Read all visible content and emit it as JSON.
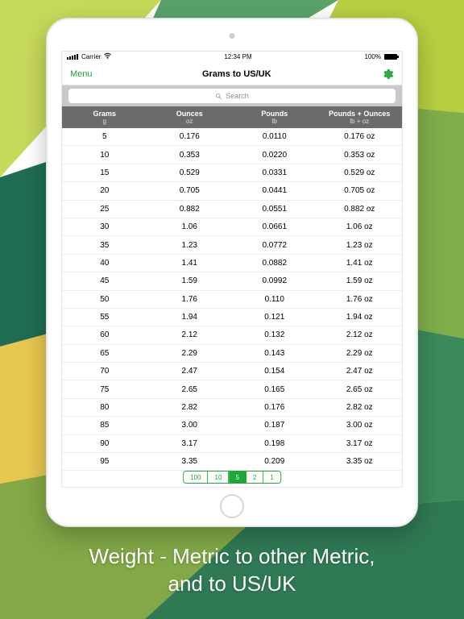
{
  "caption_line1": "Weight - Metric to other Metric,",
  "caption_line2": "and to US/UK",
  "status": {
    "carrier": "Carrier",
    "time": "12:34 PM",
    "battery": "100%"
  },
  "navbar": {
    "menu": "Menu",
    "title": "Grams to US/UK"
  },
  "search": {
    "placeholder": "Search"
  },
  "columns": [
    {
      "label": "Grams",
      "unit": "g"
    },
    {
      "label": "Ounces",
      "unit": "oz"
    },
    {
      "label": "Pounds",
      "unit": "lb"
    },
    {
      "label": "Pounds + Ounces",
      "unit": "lb + oz"
    }
  ],
  "segments": [
    "100",
    "10",
    "5",
    "2",
    "1"
  ],
  "active_segment": "5",
  "chart_data": {
    "type": "table",
    "columns": [
      "Grams (g)",
      "Ounces (oz)",
      "Pounds (lb)",
      "Pounds + Ounces (lb + oz)"
    ],
    "rows": [
      [
        "5",
        "0.176",
        "0.0110",
        "0.176 oz"
      ],
      [
        "10",
        "0.353",
        "0.0220",
        "0.353 oz"
      ],
      [
        "15",
        "0.529",
        "0.0331",
        "0.529 oz"
      ],
      [
        "20",
        "0.705",
        "0.0441",
        "0.705 oz"
      ],
      [
        "25",
        "0.882",
        "0.0551",
        "0.882 oz"
      ],
      [
        "30",
        "1.06",
        "0.0661",
        "1.06 oz"
      ],
      [
        "35",
        "1.23",
        "0.0772",
        "1.23 oz"
      ],
      [
        "40",
        "1.41",
        "0.0882",
        "1.41 oz"
      ],
      [
        "45",
        "1.59",
        "0.0992",
        "1.59 oz"
      ],
      [
        "50",
        "1.76",
        "0.110",
        "1.76 oz"
      ],
      [
        "55",
        "1.94",
        "0.121",
        "1.94 oz"
      ],
      [
        "60",
        "2.12",
        "0.132",
        "2.12 oz"
      ],
      [
        "65",
        "2.29",
        "0.143",
        "2.29 oz"
      ],
      [
        "70",
        "2.47",
        "0.154",
        "2.47 oz"
      ],
      [
        "75",
        "2.65",
        "0.165",
        "2.65 oz"
      ],
      [
        "80",
        "2.82",
        "0.176",
        "2.82 oz"
      ],
      [
        "85",
        "3.00",
        "0.187",
        "3.00 oz"
      ],
      [
        "90",
        "3.17",
        "0.198",
        "3.17 oz"
      ],
      [
        "95",
        "3.35",
        "0.209",
        "3.35 oz"
      ]
    ]
  }
}
